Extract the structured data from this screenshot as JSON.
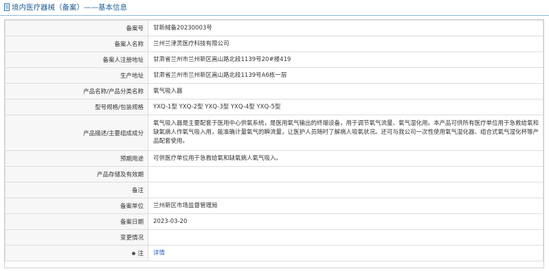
{
  "header": {
    "title": "境内医疗器械（备案）——基本信息",
    "icon": "document-icon"
  },
  "rows": [
    {
      "key": "record_no",
      "label": "备案号",
      "value": "甘新械备20230003号"
    },
    {
      "key": "registrant",
      "label": "备案人名称",
      "value": "兰州兰津灵医疗科技有限公司"
    },
    {
      "key": "registrant_address",
      "label": "备案人注册地址",
      "value": "甘肃省兰州市兰州新区嵩山路北段1139号20#楼419"
    },
    {
      "key": "production_address",
      "label": "生产地址",
      "value": "甘肃省兰州市兰州新区嵩山路北段1139号A6栋一层"
    },
    {
      "key": "product_name",
      "label": "产品名称/产品分类名称",
      "value": "氧气吸入器"
    },
    {
      "key": "model",
      "label": "型号规格/包装规格",
      "value": "YXQ-1型 YXQ-2型 YXQ-3型 YXQ-4型 YXQ-5型"
    },
    {
      "key": "description",
      "label": "产品描述/主要组成成分",
      "value": "氧气吸入器是主要配套于医用中心供氧系统，是医用氧气输出的终端设备，用于调节氧气流量、氧气湿化用。本产品可供所有医疗单位用于急救给氧和缺氧病人作氧气吸入用，能准确计量氧气的瞬流量，让医护人员随时了解病人吸氧状况。还可与我公司一次性使用氧气湿化器、组合式氧气湿化杯等产品配套使用。"
    },
    {
      "key": "intended_use",
      "label": "预期用途",
      "value": "可供医疗单位用于急救给氧和缺氧病人氧气吸入。"
    },
    {
      "key": "storage",
      "label": "产品存储及有效期",
      "value": ""
    },
    {
      "key": "remark",
      "label": "备注",
      "value": ""
    },
    {
      "key": "record_unit",
      "label": "备案单位",
      "value": "兰州新区市场监督管理局"
    },
    {
      "key": "record_date",
      "label": "备案日期",
      "value": "2023-03-20"
    },
    {
      "key": "change",
      "label": "变更情况",
      "value": ""
    },
    {
      "key": "note",
      "label": "注",
      "value": "详情"
    }
  ]
}
